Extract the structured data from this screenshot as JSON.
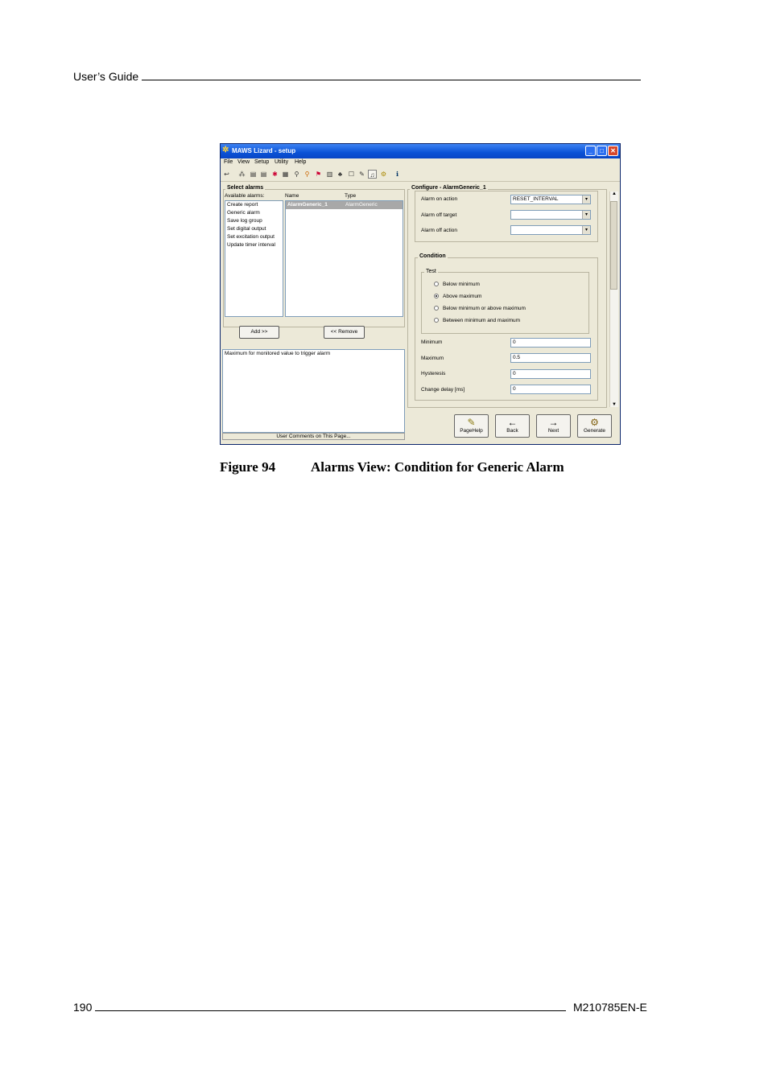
{
  "page": {
    "header": "User’s Guide",
    "page_number": "190",
    "doc_code": "M210785EN-E",
    "figure_label": "Figure 94",
    "figure_title": "Alarms View: Condition for Generic Alarm"
  },
  "window": {
    "title": "MAWS Lizard - setup",
    "menu": [
      "File",
      "View",
      "Setup",
      "Utility",
      "Help"
    ],
    "select_alarms": {
      "title": "Select alarms",
      "available_label": "Available alarms:",
      "name_col": "Name",
      "type_col": "Type",
      "available": [
        "Create report",
        "Generic alarm",
        "Save log group",
        "Set digital output",
        "Set excitation output",
        "Update timer interval"
      ],
      "selected": {
        "name": "AlarmGeneric_1",
        "type": "AlarmGeneric"
      },
      "add_label": "Add >>",
      "remove_label": "<< Remove",
      "comment_text": "Maximum for monitored value to trigger alarm",
      "comments_footer": "User Comments on This Page..."
    },
    "configure": {
      "title": "Configure - AlarmGeneric_1",
      "alarm_on_action_label": "Alarm on action",
      "alarm_on_action_value": "RESET_INTERVAL",
      "alarm_off_target_label": "Alarm off target",
      "alarm_off_target_value": "",
      "alarm_off_action_label": "Alarm off action",
      "alarm_off_action_value": "",
      "condition_title": "Condition",
      "test_title": "Test",
      "options": [
        "Below minimum",
        "Above maximum",
        "Below minimum or above maximum",
        "Between minimum and maximum"
      ],
      "selected_option": "Above maximum",
      "minimum_label": "Minimum",
      "minimum_value": "0",
      "maximum_label": "Maximum",
      "maximum_value": "0.5",
      "hysteresis_label": "Hysteresis",
      "hysteresis_value": "0",
      "change_delay_label": "Change delay [ms]",
      "change_delay_value": "0"
    },
    "nav": {
      "pagehelp": "PageHelp",
      "back": "Back",
      "next": "Next",
      "generate": "Generate"
    }
  }
}
